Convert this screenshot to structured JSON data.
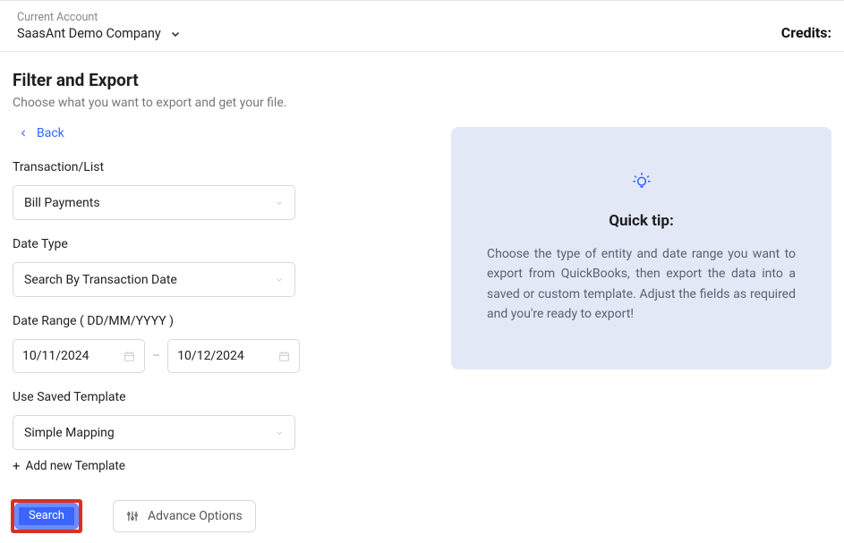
{
  "header": {
    "account_label": "Current Account",
    "account_name": "SaasAnt Demo Company",
    "credits_label": "Credits:"
  },
  "page": {
    "title": "Filter and Export",
    "subtitle": "Choose what you want to export and get your file.",
    "back_link": "Back"
  },
  "form": {
    "transaction": {
      "label": "Transaction/List",
      "value": "Bill Payments"
    },
    "date_type": {
      "label": "Date Type",
      "value": "Search By Transaction Date"
    },
    "date_range": {
      "label": "Date Range ( DD/MM/YYYY )",
      "from": "10/11/2024",
      "to": "10/12/2024",
      "separator": "–"
    },
    "template": {
      "label": "Use Saved Template",
      "value": "Simple Mapping",
      "add_new": "Add new Template"
    },
    "buttons": {
      "search": "Search",
      "advance": "Advance Options"
    }
  },
  "tip": {
    "title": "Quick tip:",
    "body": "Choose the type of entity and date range you want to export from QuickBooks, then export the data into a saved or custom template. Adjust the fields as required and you're ready to export!"
  }
}
